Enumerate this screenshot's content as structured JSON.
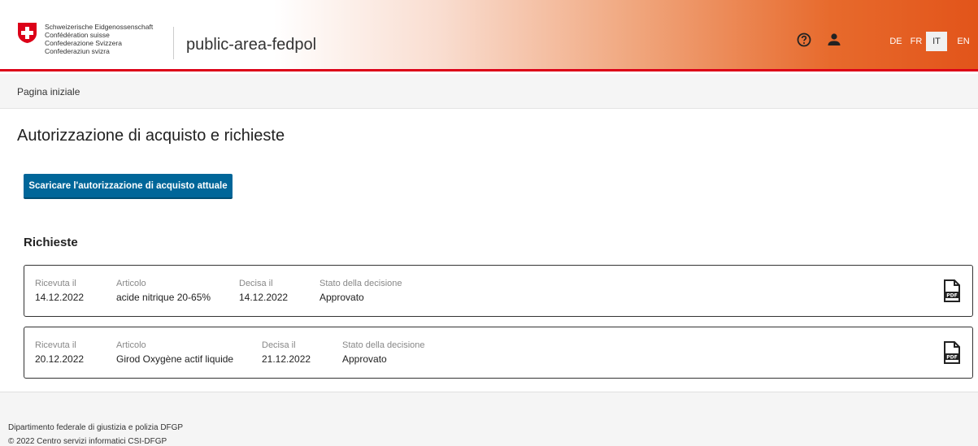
{
  "header": {
    "confederation_lines": [
      "Schweizerische Eidgenossenschaft",
      "Confédération suisse",
      "Confederazione Svizzera",
      "Confederaziun svizra"
    ],
    "app_title": "public-area-fedpol",
    "languages": [
      {
        "code": "DE",
        "active": false
      },
      {
        "code": "FR",
        "active": false
      },
      {
        "code": "IT",
        "active": true
      },
      {
        "code": "EN",
        "active": false
      }
    ],
    "icons": {
      "help": "help-circle-icon",
      "user": "user-icon"
    }
  },
  "breadcrumb": {
    "home": "Pagina iniziale"
  },
  "page": {
    "title": "Autorizzazione di acquisto e richieste",
    "download_button": "Scaricare l'autorizzazione di acquisto attuale",
    "section_title": "Richieste"
  },
  "labels": {
    "received": "Ricevuta il",
    "article": "Articolo",
    "decided": "Decisa il",
    "status": "Stato della decisione"
  },
  "requests": [
    {
      "received": "14.12.2022",
      "article": "acide nitrique 20-65%",
      "decided": "14.12.2022",
      "status": "Approvato",
      "icon": "pdf-file-icon"
    },
    {
      "received": "20.12.2022",
      "article": "Girod Oxygène actif liquide",
      "decided": "21.12.2022",
      "status": "Approvato",
      "icon": "pdf-file-icon"
    }
  ],
  "footer": {
    "line1": "Dipartimento federale di giustizia e polizia DFGP",
    "line2": "© 2022 Centro servizi informatici CSI-DFGP"
  },
  "colors": {
    "accent": "#dc0018",
    "button": "#006699",
    "header_orange": "#e2541a"
  }
}
